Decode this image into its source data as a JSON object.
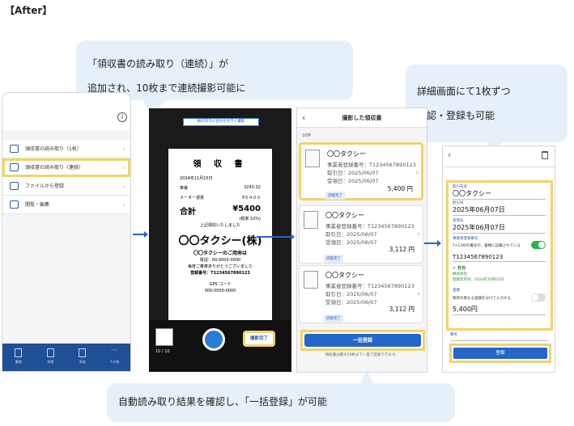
{
  "title": "【After】",
  "callouts": {
    "top_line1": "「領収書の読み取り（連続）」が",
    "top_line2": "追加され、10枚まで連続撮影可能に",
    "right_line1": "詳細画面にて1枚ずつ",
    "right_line2": "確認・登録も可能",
    "bottom": "自動読み取り結果を確認し、「一括登録」が可能"
  },
  "phone1": {
    "info_icon": "info-icon",
    "menu": [
      {
        "label": "領収書の読み取り（1枚）",
        "icon": "camera-icon"
      },
      {
        "label": "領収書の読み取り（連続）",
        "icon": "camera-icon"
      },
      {
        "label": "ファイルから登録",
        "icon": "file-add-icon"
      },
      {
        "label": "閲覧・編集",
        "icon": "edit-icon"
      }
    ],
    "tabs": [
      {
        "label": "書類",
        "icon": "document-icon"
      },
      {
        "label": "申請",
        "icon": "apply-icon"
      },
      {
        "label": "承認",
        "icon": "approve-icon"
      },
      {
        "label": "その他",
        "icon": "more-icon"
      }
    ]
  },
  "phone2": {
    "guide": "紙の向きに合わせ大きく撮影",
    "counter": "10 / 10",
    "done_button": "撮影完了",
    "receipt": {
      "title": "領 収 書",
      "date": "2024年11月15日",
      "rows": [
        {
          "label": "車番",
          "value": "3243-32"
        },
        {
          "label": "メーター運賃",
          "value": "¥５４００"
        }
      ],
      "total_label": "合計",
      "total_value": "¥5400",
      "tax_note": "(税率 10%)",
      "received": "上記領収いたしました",
      "company": "〇〇タクシー(株)",
      "use": "〇〇タクシーのご用命は",
      "phone": "電話：00-0000-0000",
      "thanks": "毎度ご乗車ありがとうございました",
      "regno": "登録番号：T1234567890123",
      "gps": "GPS コード",
      "gps_code": "000-0000-0000"
    }
  },
  "phone3": {
    "title": "撮影した領収書",
    "count": "10件",
    "cards": [
      {
        "name": "〇〇タクシー",
        "reg": "事業者登録番号：T1234567890123",
        "date": "取引日：2025/06/07",
        "recv": "受領日：2025/06/07",
        "amount": "5,400 円",
        "badge": "読取完了"
      },
      {
        "name": "〇〇タクシー",
        "reg": "事業者登録番号：T1234567890123",
        "date": "取引日：2025/06/07",
        "recv": "受領日：2025/06/07",
        "amount": "3,112 円",
        "badge": "読取完了"
      },
      {
        "name": "〇〇タクシー",
        "reg": "事業者登録番号：T1234567890123",
        "date": "取引日：2025/06/07",
        "recv": "受領日：2025/06/07",
        "amount": "3,112 円",
        "badge": "読取完了"
      }
    ],
    "bulk_button": "一括登録",
    "note": "領収書は最大10枚まで一度で登録できます。"
  },
  "phone4": {
    "payee_label": "取引先名",
    "payee": "〇〇タクシー",
    "txn_label": "取引日",
    "txn_date": "2025年06月07日",
    "recv_label": "受領日",
    "recv_date": "2025年06月07日",
    "regno_label": "事業者登録番号",
    "t13_text": "T+13桁の番号が、書類に記載されている",
    "regno": "T1234567890123",
    "valid": "有効",
    "company_line1": "株式会社",
    "company_line2": "登録年月日：2023年10月01日",
    "amount_label": "金額",
    "tax_rate_text": "税率の異なる金額を分けて入力する",
    "amount": "5,400円",
    "memo_label": "備考",
    "register_button": "登録"
  }
}
